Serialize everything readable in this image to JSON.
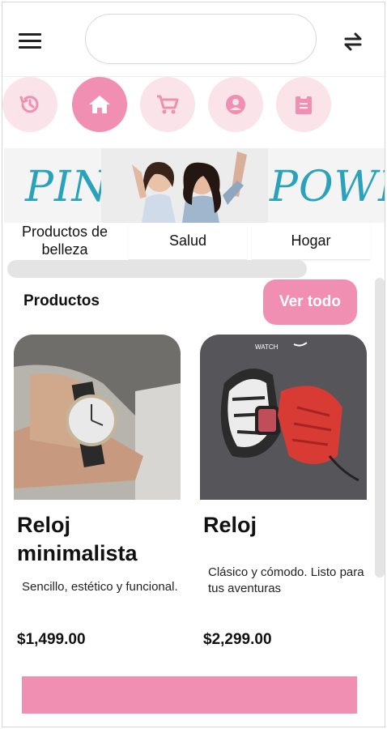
{
  "search": {
    "placeholder": "",
    "value": ""
  },
  "nav": [
    {
      "icon": "history-icon",
      "active": false
    },
    {
      "icon": "home-icon",
      "active": true
    },
    {
      "icon": "cart-icon",
      "active": false
    },
    {
      "icon": "account-icon",
      "active": false
    },
    {
      "icon": "clipboard-icon",
      "active": false
    }
  ],
  "banner": {
    "word_left": "PINK",
    "word_right": "POWER"
  },
  "categories": [
    "Productos de belleza",
    "Salud",
    "Hogar"
  ],
  "products_section": {
    "title": "Productos",
    "see_all": "Ver todo"
  },
  "products": [
    {
      "name": "Reloj minimalista",
      "description": "Sencillo, estético y funcional.",
      "price": "$1,499.00"
    },
    {
      "name": "Reloj",
      "description": "Clásico y cómodo. Listo para tus aventuras",
      "price": "$2,299.00",
      "image_text": "WATCH"
    }
  ],
  "colors": {
    "accent": "#f18fb2",
    "accent_light": "#fbe3ea",
    "banner_text": "#2aa2bc"
  }
}
